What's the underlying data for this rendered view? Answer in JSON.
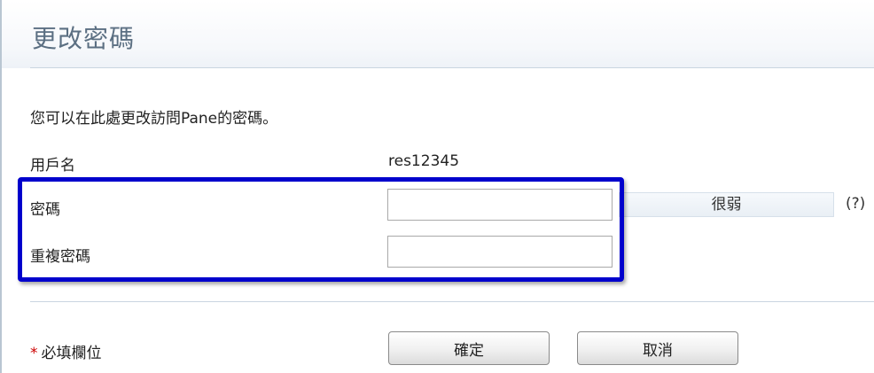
{
  "header": {
    "title": "更改密碼"
  },
  "description": "您可以在此處更改訪問Pane的密碼。",
  "form": {
    "username": {
      "label": "用戶名",
      "value": "res12345"
    },
    "password": {
      "label": "密碼",
      "value": "",
      "strength_text": "很弱",
      "help_text": "(?)"
    },
    "repeat_password": {
      "label": "重複密碼",
      "value": ""
    }
  },
  "footer": {
    "required_star": "*",
    "required_text": "必填欄位",
    "ok_label": "確定",
    "cancel_label": "取消"
  },
  "colors": {
    "title": "#5b6f82",
    "highlight": "#0000cc",
    "required_star": "#cc0000"
  }
}
